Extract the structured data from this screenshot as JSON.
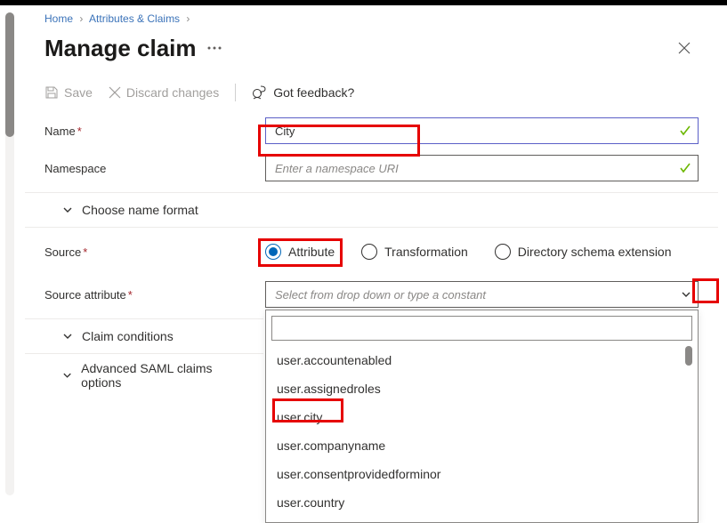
{
  "breadcrumb": {
    "home": "Home",
    "attributes": "Attributes & Claims"
  },
  "header": {
    "title": "Manage claim"
  },
  "toolbar": {
    "save": "Save",
    "discard": "Discard changes",
    "feedback": "Got feedback?"
  },
  "form": {
    "nameLabel": "Name",
    "nameValue": "City",
    "namespaceLabel": "Namespace",
    "namespacePlaceholder": "Enter a namespace URI",
    "sourceLabel": "Source",
    "sourceAttrLabel": "Source attribute",
    "sourceAttrPlaceholder": "Select from drop down or type a constant"
  },
  "sections": {
    "chooseNameFormat": "Choose name format",
    "claimConditions": "Claim conditions",
    "advancedSaml": "Advanced SAML claims options"
  },
  "radio": {
    "attribute": "Attribute",
    "transformation": "Transformation",
    "dse": "Directory schema extension"
  },
  "options": [
    "user.accountenabled",
    "user.assignedroles",
    "user.city",
    "user.companyname",
    "user.consentprovidedforminor",
    "user.country"
  ]
}
